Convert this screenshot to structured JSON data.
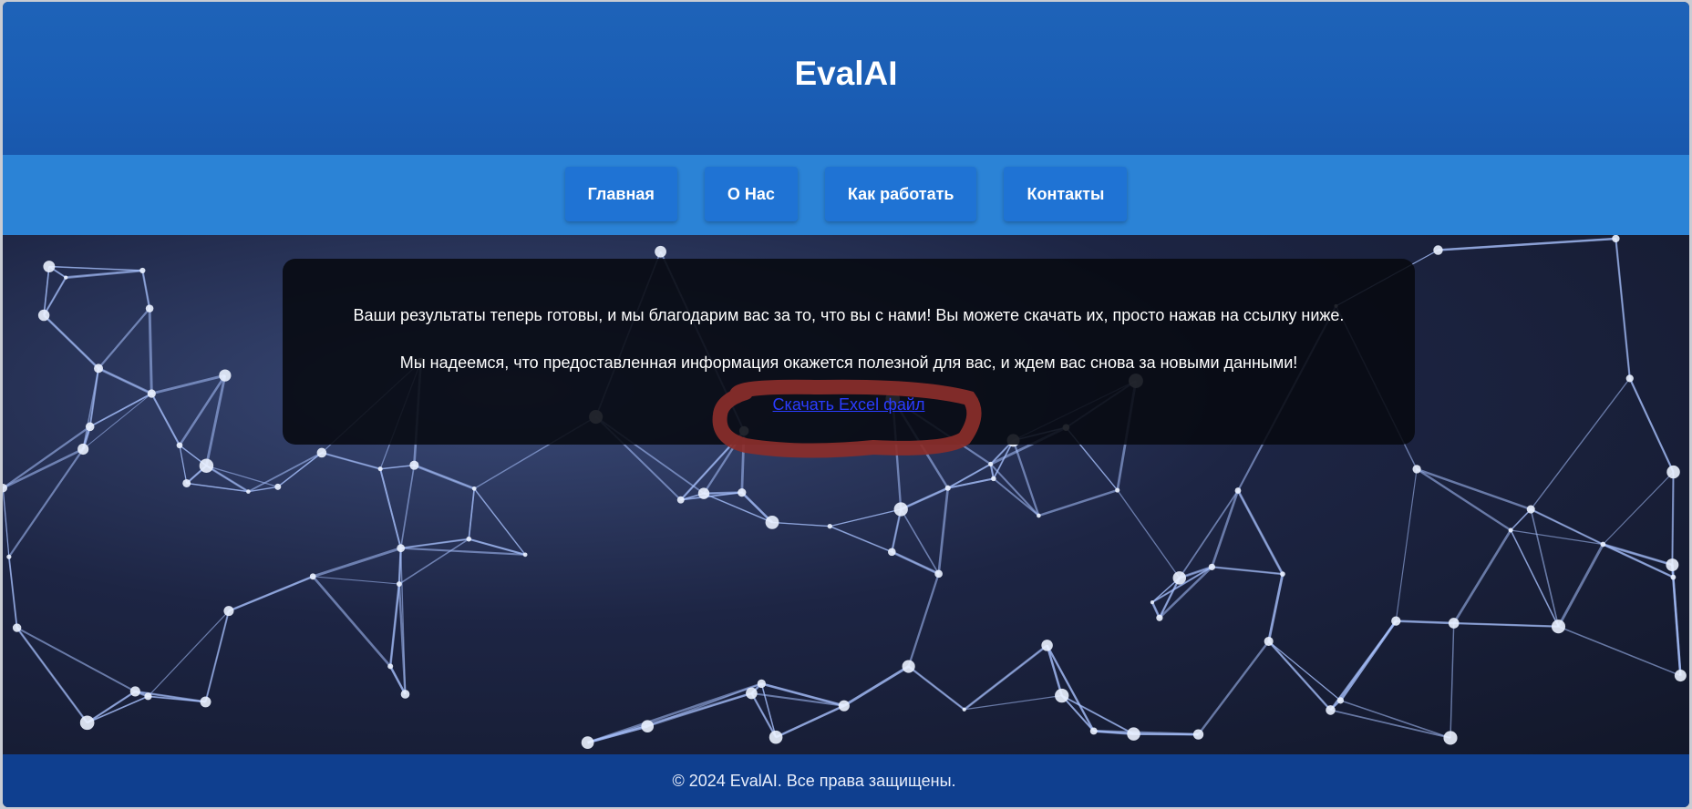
{
  "header": {
    "title": "EvalAI"
  },
  "nav": {
    "items": [
      {
        "label": "Главная"
      },
      {
        "label": "О Нас"
      },
      {
        "label": "Как работать"
      },
      {
        "label": "Контакты"
      }
    ]
  },
  "main": {
    "message_1": "Ваши результаты теперь готовы, и мы благодарим вас за то, что вы с нами! Вы можете скачать их, просто нажав на ссылку ниже.",
    "message_2": "Мы надеемся, что предоставленная информация окажется полезной для вас, и ждем вас снова за новыми данными!",
    "download_link": "Скачать Excel файл"
  },
  "footer": {
    "copyright": "© 2024 EvalAI. Все права защищены."
  },
  "colors": {
    "header_bg": "#1a5db4",
    "nav_bg": "#2b83d6",
    "nav_button_bg": "#1f73d4",
    "footer_bg": "#0f3f8f",
    "link": "#2a3cff",
    "annotation_circle": "#8b2e2a"
  }
}
